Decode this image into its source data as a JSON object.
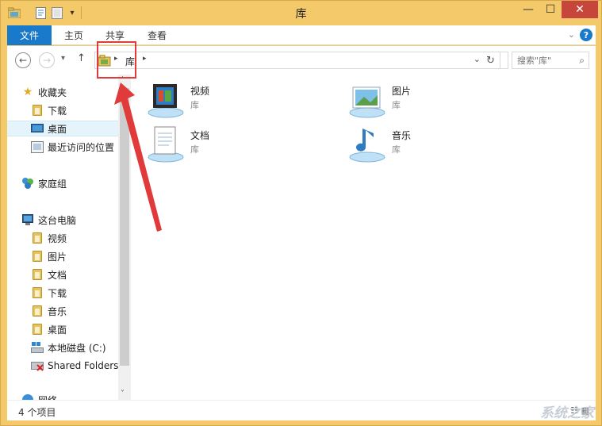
{
  "window": {
    "title": "库",
    "minimize": "—",
    "maximize": "☐",
    "close": "✕"
  },
  "quick_access": {
    "dropdown": "▾"
  },
  "ribbon": {
    "tabs": [
      "文件",
      "主页",
      "共享",
      "查看"
    ],
    "expand": "⌄",
    "help": "?"
  },
  "nav": {
    "back": "←",
    "forward": "→",
    "recent": "▾",
    "up": "↑",
    "crumb_arrow": "▸",
    "crumb": "库",
    "address_dropdown": "⌄",
    "refresh": "↻",
    "search_placeholder": "搜索\"库\"",
    "search_icon": "⌕"
  },
  "sidebar": {
    "favorites": {
      "label": "收藏夹",
      "icon": "star-icon"
    },
    "favorite_items": [
      {
        "label": "下载",
        "icon": "downloads-folder-icon"
      },
      {
        "label": "桌面",
        "icon": "desktop-icon",
        "selected": true
      },
      {
        "label": "最近访问的位置",
        "icon": "recent-places-icon"
      }
    ],
    "homegroup": {
      "label": "家庭组",
      "icon": "homegroup-icon"
    },
    "thispc": {
      "label": "这台电脑",
      "icon": "computer-icon"
    },
    "pc_items": [
      {
        "label": "视频",
        "icon": "videos-folder-icon"
      },
      {
        "label": "图片",
        "icon": "pictures-folder-icon"
      },
      {
        "label": "文档",
        "icon": "documents-folder-icon"
      },
      {
        "label": "下载",
        "icon": "downloads-folder-icon"
      },
      {
        "label": "音乐",
        "icon": "music-folder-icon"
      },
      {
        "label": "桌面",
        "icon": "desktop-folder-icon"
      },
      {
        "label": "本地磁盘 (C:)",
        "icon": "local-disk-icon"
      },
      {
        "label": "Shared Folders",
        "icon": "shared-folders-icon"
      }
    ],
    "network": {
      "label": "网络",
      "icon": "network-icon"
    },
    "scroll_up": "˄",
    "scroll_down": "˅"
  },
  "libraries": [
    {
      "name": "视频",
      "type": "库",
      "icon": "videos-library-icon"
    },
    {
      "name": "图片",
      "type": "库",
      "icon": "pictures-library-icon"
    },
    {
      "name": "文档",
      "type": "库",
      "icon": "documents-library-icon"
    },
    {
      "name": "音乐",
      "type": "库",
      "icon": "music-library-icon"
    }
  ],
  "status": {
    "count": "4 个项目",
    "views": "☷ ▦"
  },
  "watermark": "系统之家",
  "colors": {
    "accent": "#1979ca",
    "window_frame": "#f3c969",
    "close": "#c7463b",
    "annotation": "#e03a3a"
  }
}
